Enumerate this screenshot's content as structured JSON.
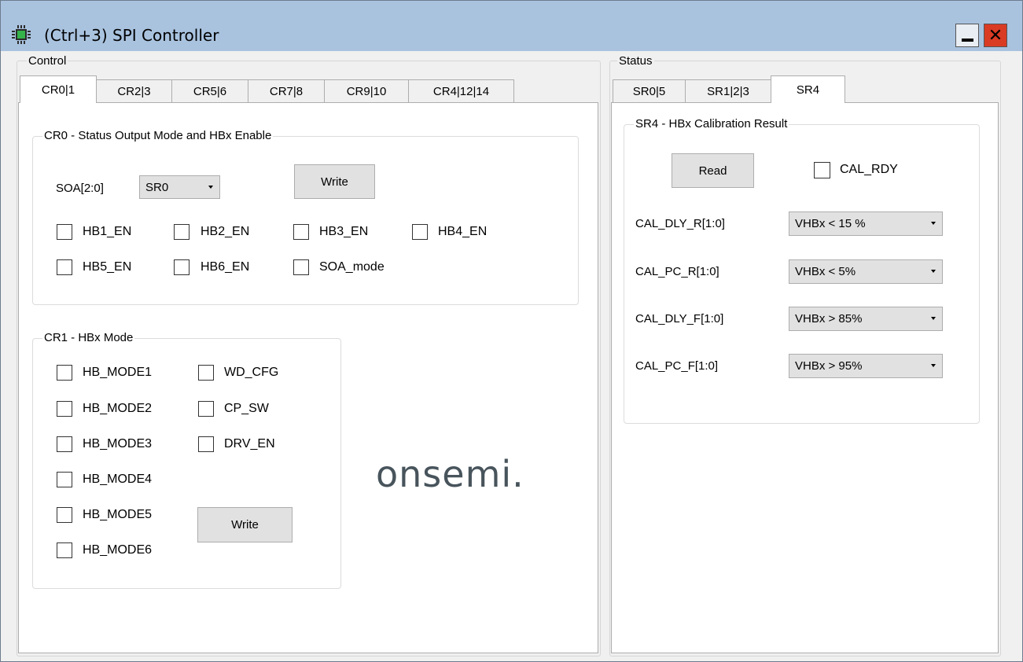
{
  "window": {
    "title": "(Ctrl+3) SPI Controller",
    "close_glyph": "✕",
    "icons": {
      "app": "chip-icon",
      "minimize": "minimize-icon",
      "close": "close-icon"
    },
    "colors": {
      "titlebar": "#a9c3df",
      "close": "#d93b23"
    }
  },
  "control": {
    "group_label": "Control",
    "tabs": [
      {
        "label": "CR0|1",
        "active": true
      },
      {
        "label": "CR2|3",
        "active": false
      },
      {
        "label": "CR5|6",
        "active": false
      },
      {
        "label": "CR7|8",
        "active": false
      },
      {
        "label": "CR9|10",
        "active": false
      },
      {
        "label": "CR4|12|14",
        "active": false
      }
    ],
    "cr0": {
      "title": "CR0 - Status Output Mode and HBx Enable",
      "soa_label": "SOA[2:0]",
      "soa_value": "SR0",
      "write_label": "Write",
      "checkboxes": [
        "HB1_EN",
        "HB2_EN",
        "HB3_EN",
        "HB4_EN",
        "HB5_EN",
        "HB6_EN",
        "SOA_mode"
      ]
    },
    "cr1": {
      "title": "CR1 - HBx Mode",
      "left_checkboxes": [
        "HB_MODE1",
        "HB_MODE2",
        "HB_MODE3",
        "HB_MODE4",
        "HB_MODE5",
        "HB_MODE6"
      ],
      "right_checkboxes": [
        "WD_CFG",
        "CP_SW",
        "DRV_EN"
      ],
      "write_label": "Write"
    },
    "logo_text": "onsemi."
  },
  "status": {
    "group_label": "Status",
    "tabs": [
      {
        "label": "SR0|5",
        "active": false
      },
      {
        "label": "SR1|2|3",
        "active": false
      },
      {
        "label": "SR4",
        "active": true
      }
    ],
    "sr4": {
      "title": "SR4 - HBx Calibration Result",
      "read_label": "Read",
      "cal_rdy_label": "CAL_RDY",
      "fields": [
        {
          "label": "CAL_DLY_R[1:0]",
          "value": "VHBx < 15 %"
        },
        {
          "label": "CAL_PC_R[1:0]",
          "value": "VHBx < 5%"
        },
        {
          "label": "CAL_DLY_F[1:0]",
          "value": "VHBx > 85%"
        },
        {
          "label": "CAL_PC_F[1:0]",
          "value": "VHBx > 95%"
        }
      ]
    }
  }
}
